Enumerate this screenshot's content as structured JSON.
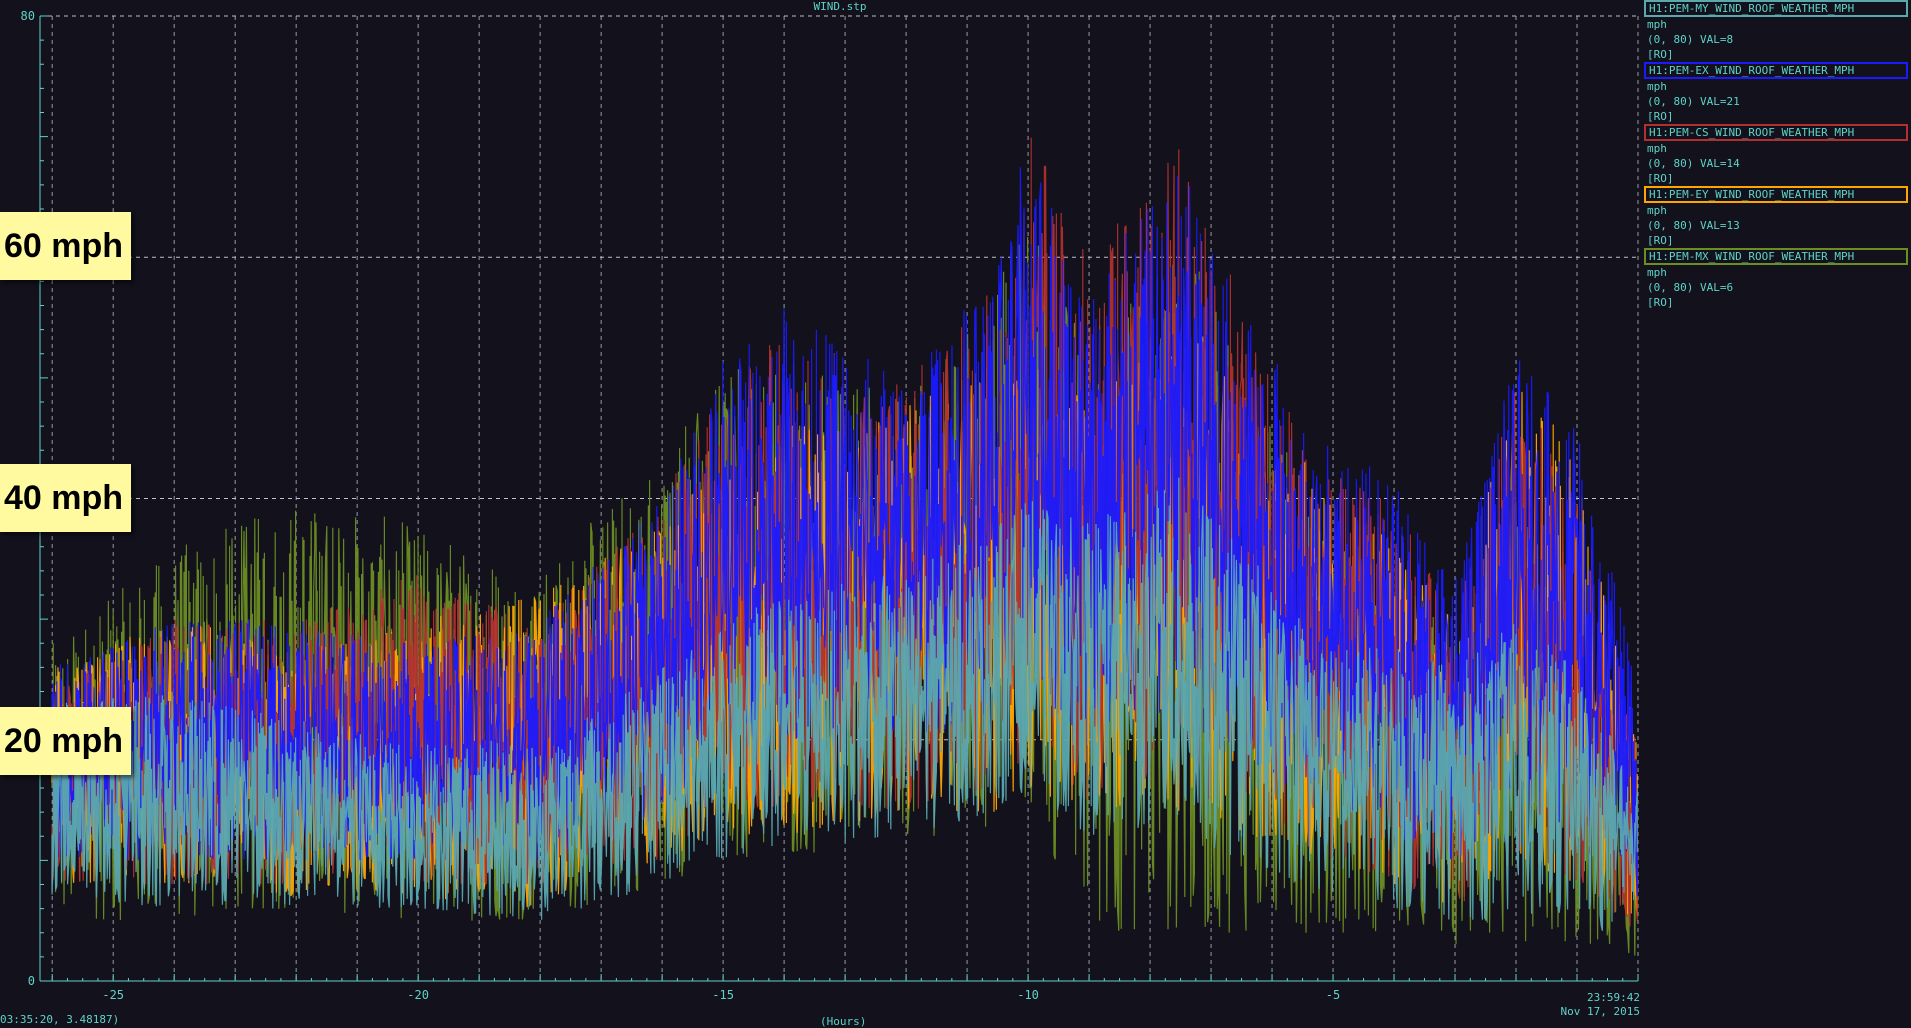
{
  "title": "WIND.stp",
  "legend": [
    {
      "name": "H1:PEM-MY_WIND_ROOF_WEATHER_MPH",
      "units": "mph",
      "range_val": "(0, 80) VAL=8",
      "ro": "[RO]",
      "color": "#5aa8b0"
    },
    {
      "name": "H1:PEM-EX_WIND_ROOF_WEATHER_MPH",
      "units": "mph",
      "range_val": "(0, 80) VAL=21",
      "ro": "[RO]",
      "color": "#1a1aff"
    },
    {
      "name": "H1:PEM-CS_WIND_ROOF_WEATHER_MPH",
      "units": "mph",
      "range_val": "(0, 80) VAL=14",
      "ro": "[RO]",
      "color": "#b03030"
    },
    {
      "name": "H1:PEM-EY_WIND_ROOF_WEATHER_MPH",
      "units": "mph",
      "range_val": "(0, 80) VAL=13",
      "ro": "[RO]",
      "color": "#ffa500"
    },
    {
      "name": "H1:PEM-MX_WIND_ROOF_WEATHER_MPH",
      "units": "mph",
      "range_val": "(0, 80) VAL=6",
      "ro": "[RO]",
      "color": "#6b8e23"
    }
  ],
  "annotations": [
    "60 mph",
    "40 mph",
    "20 mph"
  ],
  "cursor_readout": "03:35:20, 3.48187)",
  "end_time": "23:59:42",
  "end_date": "Nov 17, 2015",
  "x_units": "(Hours)",
  "chart_data": {
    "type": "line",
    "title": "WIND.stp",
    "xlabel": "(Hours)",
    "ylabel": "",
    "xlim": [
      -26.2,
      0
    ],
    "ylim": [
      0,
      80
    ],
    "x_ticks": [
      -25,
      -20,
      -15,
      -10,
      -5
    ],
    "y_tick_labels": [
      "0",
      "80"
    ],
    "grid": true,
    "legend_position": "right",
    "annotation_levels": [
      60,
      40,
      20
    ],
    "envelope_x": [
      -26,
      -24,
      -22,
      -20,
      -18,
      -16,
      -15,
      -14,
      -12,
      -10.5,
      -10,
      -9,
      -7.5,
      -6.5,
      -5,
      -4,
      -3,
      -2,
      -1,
      0
    ],
    "series": [
      {
        "name": "H1:PEM-MY_WIND_ROOF_WEATHER_MPH",
        "color": "#5aa8b0",
        "last_value": 8,
        "upper": [
          24,
          24,
          22,
          20,
          20,
          26,
          30,
          32,
          34,
          38,
          40,
          38,
          42,
          36,
          28,
          28,
          26,
          30,
          26,
          16
        ],
        "lower": [
          7,
          6,
          6,
          6,
          5,
          8,
          10,
          11,
          12,
          14,
          16,
          12,
          12,
          10,
          7,
          6,
          5,
          5,
          5,
          3
        ]
      },
      {
        "name": "H1:PEM-EX_WIND_ROOF_WEATHER_MPH",
        "color": "#1a1aff",
        "last_value": 21,
        "upper": [
          26,
          30,
          30,
          28,
          30,
          40,
          52,
          56,
          50,
          60,
          70,
          58,
          68,
          56,
          44,
          42,
          34,
          52,
          46,
          26
        ],
        "lower": [
          10,
          10,
          10,
          10,
          10,
          14,
          18,
          20,
          20,
          22,
          24,
          20,
          22,
          18,
          14,
          12,
          10,
          14,
          12,
          6
        ]
      },
      {
        "name": "H1:PEM-CS_WIND_ROOF_WEATHER_MPH",
        "color": "#b03030",
        "last_value": 14,
        "upper": [
          24,
          30,
          30,
          34,
          30,
          40,
          50,
          54,
          50,
          58,
          72,
          60,
          70,
          56,
          42,
          40,
          30,
          50,
          40,
          20
        ],
        "lower": [
          8,
          8,
          8,
          8,
          8,
          10,
          14,
          14,
          14,
          16,
          18,
          14,
          16,
          14,
          10,
          8,
          6,
          10,
          8,
          4
        ]
      },
      {
        "name": "H1:PEM-EY_WIND_ROOF_WEATHER_MPH",
        "color": "#ffa500",
        "last_value": 13,
        "upper": [
          26,
          30,
          28,
          30,
          32,
          38,
          44,
          46,
          48,
          50,
          54,
          50,
          58,
          50,
          40,
          38,
          30,
          50,
          44,
          20
        ],
        "lower": [
          8,
          8,
          7,
          7,
          6,
          10,
          12,
          12,
          14,
          14,
          16,
          14,
          14,
          12,
          10,
          8,
          6,
          10,
          8,
          5
        ]
      },
      {
        "name": "H1:PEM-MX_WIND_ROOF_WEATHER_MPH",
        "color": "#6b8e23",
        "last_value": 6,
        "upper": [
          28,
          36,
          40,
          38,
          34,
          44,
          52,
          52,
          48,
          58,
          64,
          54,
          62,
          52,
          36,
          36,
          28,
          40,
          28,
          14
        ],
        "lower": [
          5,
          5,
          6,
          5,
          5,
          8,
          10,
          10,
          12,
          12,
          14,
          4,
          4,
          4,
          4,
          4,
          3,
          3,
          3,
          2
        ]
      }
    ]
  }
}
